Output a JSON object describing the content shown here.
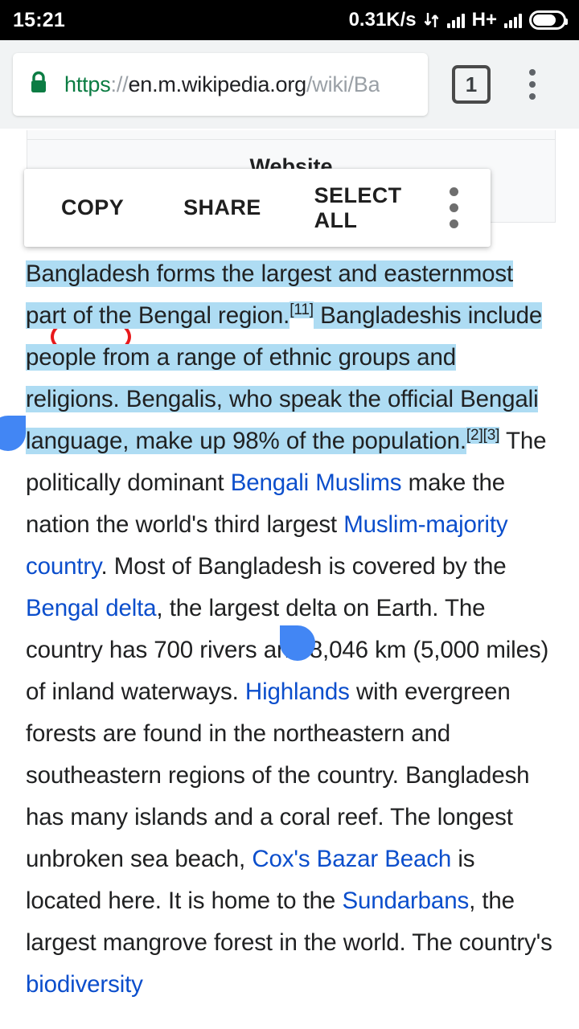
{
  "status_bar": {
    "clock": "15:21",
    "net_speed": "0.31K/s",
    "network_type": "H+",
    "icons": [
      "data-transfer-icon",
      "signal-bars-icon",
      "signal-bars-icon",
      "battery-icon"
    ]
  },
  "browser": {
    "url": {
      "scheme": "https",
      "punct": "://",
      "host": "en.m.wikipedia.org",
      "path": "/wiki/Ba"
    },
    "tab_count": "1",
    "lock_color": "#0b7c43",
    "menu_label": "chrome-menu"
  },
  "infobox": {
    "heading": "Website"
  },
  "select_popup": {
    "actions": [
      {
        "label": "COPY",
        "highlighted": true
      },
      {
        "label": "SHARE",
        "highlighted": false
      },
      {
        "label": "SELECT ALL",
        "highlighted": false
      }
    ],
    "overflow_label": "more-options",
    "annotation_color": "#e8191b"
  },
  "selection": {
    "highlight_color": "#aedcf3",
    "handle_color": "#4286f4"
  },
  "article": {
    "selected_text": {
      "seg1": "Bangladesh forms the largest and easternmost part of the Bengal region.",
      "ref1": "[11]",
      "seg2": " Bangladeshis include people from a range of ethnic groups and religions. Bengalis, who speak the official Bengali language, make up 98% of the population.",
      "ref2": "[2]",
      "ref3": "[3]"
    },
    "rest": {
      "t1": " The politically dominant ",
      "l1": "Bengali Muslims",
      "t2": " make the nation the world's third largest ",
      "l2": "Muslim-majority country",
      "t3": ". Most of Bangladesh is covered by the ",
      "l3": "Bengal delta",
      "t4": ", the largest delta on Earth. The country has 700 rivers and 8,046 km (5,000 miles) of inland waterways. ",
      "l4": "Highlands",
      "t5": " with evergreen forests are found in the northeastern and southeastern regions of the country. Bangladesh has many islands and a coral reef. The longest unbroken sea beach, ",
      "l5": "Cox's Bazar Beach",
      "t6": " is located here. It is home to the ",
      "l6": "Sundarbans",
      "t7": ", the largest mangrove forest in the world. The country's ",
      "l7": "biodiversity"
    }
  }
}
